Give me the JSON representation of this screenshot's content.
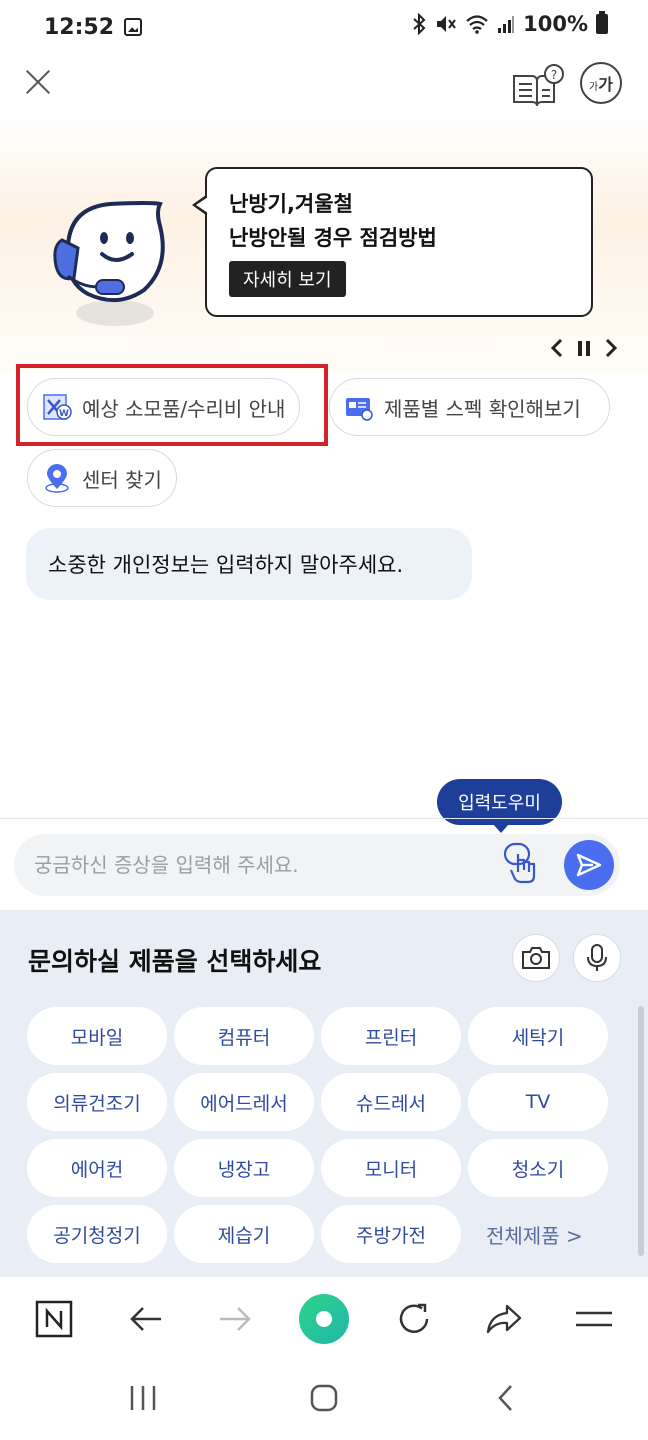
{
  "status_bar": {
    "time": "12:52",
    "battery": "100%"
  },
  "banner": {
    "line1": "난방기,겨울철",
    "line2": "난방안될 경우 점검방법",
    "more_label": "자세히 보기"
  },
  "quick_chips": {
    "repair_cost": "예상 소모품/수리비 안내",
    "spec_check": "제품별 스펙 확인해보기",
    "find_center": "센터 찾기"
  },
  "notice_message": "소중한 개인정보는 입력하지 말아주세요.",
  "input": {
    "helper_label": "입력도우미",
    "placeholder": "궁금하신 증상을 입력해 주세요."
  },
  "product_panel": {
    "title": "문의하실 제품을 선택하세요",
    "products": [
      "모바일",
      "컴퓨터",
      "프린터",
      "세탁기",
      "의류건조기",
      "에어드레서",
      "슈드레서",
      "TV",
      "에어컨",
      "냉장고",
      "모니터",
      "청소기",
      "공기청정기",
      "제습기",
      "주방가전"
    ],
    "all_label": "전체제품",
    "all_chevron": ">"
  },
  "font_button": {
    "large": "가",
    "small": "가"
  },
  "colors": {
    "accent": "#4b6ef0",
    "helper_pill": "#1e3f99",
    "product_text": "#2f4aa0",
    "highlight_box": "#d2232a",
    "notice_bg": "#edf1f8",
    "panel_bg": "#e8edf6"
  }
}
